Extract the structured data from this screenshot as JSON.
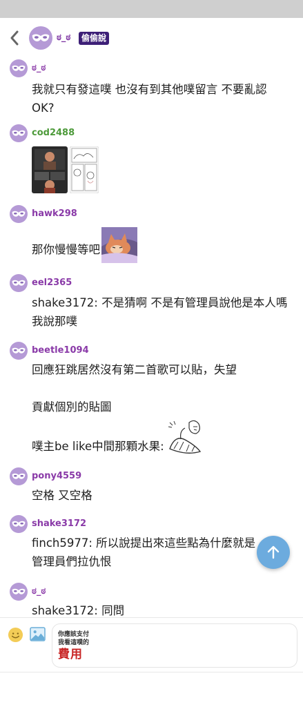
{
  "header": {
    "back_icon": "chevron-left-icon",
    "avatar_icon": "anonymous-mask-icon",
    "poster_name": "ಠ_ಠ",
    "badge": "偷偷說"
  },
  "responses": [
    {
      "username": "ಠ_ಠ",
      "name_color": "#8a3aa8",
      "lines": [
        "我就只有發這噗 也沒有到其他噗留言 不要亂認",
        "OK?"
      ]
    },
    {
      "username": "cod2488",
      "name_color": "#4d9a3a",
      "images": [
        "meme-image-1",
        "manga-image-2"
      ]
    },
    {
      "username": "hawk298",
      "name_color": "#8a3aa8",
      "text": "那你慢慢等吧",
      "sticker": "cat-sticker"
    },
    {
      "username": "eel2365",
      "name_color": "#8a3aa8",
      "lines": [
        "shake3172: 不是猜啊 不是有管理員說他是本人嗎",
        "我說那噗"
      ]
    },
    {
      "username": "beetle1094",
      "name_color": "#8a3aa8",
      "lines": [
        "回應狂跳居然沒有第二首歌可以貼，失望",
        "",
        "貢獻個別的貼圖",
        ""
      ],
      "last_line": "噗主be like中間那顆水果:",
      "sticker": "sketch-fruit-sticker"
    },
    {
      "username": "pony4559",
      "name_color": "#8a3aa8",
      "lines": [
        "空格 又空格"
      ]
    },
    {
      "username": "shake3172",
      "name_color": "#8a3aa8",
      "lines": [
        "finch5977: 所以說提出來這些點為什麼就是",
        "管理員們拉仇恨"
      ]
    },
    {
      "username": "ಠ_ಠ",
      "name_color": "#8a3aa8",
      "lines": [
        "shake3172: 同問"
      ]
    }
  ],
  "scroll_top_icon": "arrow-up-icon",
  "compose": {
    "emoji_icon": "smiley-icon",
    "image_icon": "image-upload-icon",
    "placeholder_line1": "你應該支付",
    "placeholder_line2": "我看這噗的",
    "placeholder_line3": "費用"
  },
  "colors": {
    "accent_purple": "#8a3aa8",
    "badge_bg": "#3d1f77",
    "scroll_button": "#6cabde",
    "mask_bg": "#b59ad6"
  }
}
